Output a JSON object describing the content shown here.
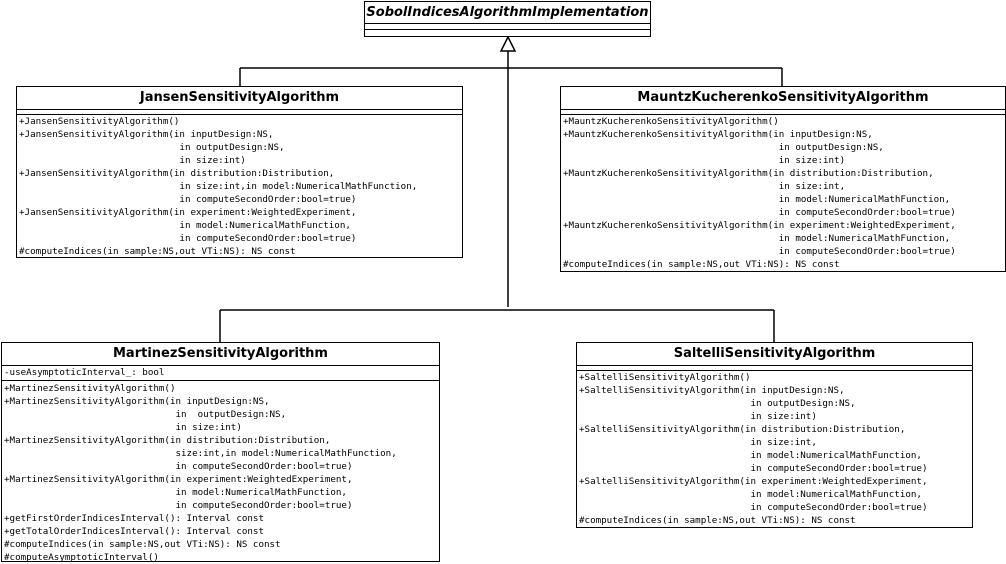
{
  "parent": {
    "name": "SobolIndicesAlgorithmImplementation"
  },
  "jansen": {
    "name": "JansenSensitivityAlgorithm",
    "operations": [
      "+JansenSensitivityAlgorithm()",
      "+JansenSensitivityAlgorithm(in inputDesign:NS,",
      "                             in outputDesign:NS,",
      "                             in size:int)",
      "+JansenSensitivityAlgorithm(in distribution:Distribution,",
      "                             in size:int,in model:NumericalMathFunction,",
      "                             in computeSecondOrder:bool=true)",
      "+JansenSensitivityAlgorithm(in experiment:WeightedExperiment,",
      "                             in model:NumericalMathFunction,",
      "                             in computeSecondOrder:bool=true)",
      "#computeIndices(in sample:NS,out VTi:NS): NS const"
    ]
  },
  "mauntz": {
    "name": "MauntzKucherenkoSensitivityAlgorithm",
    "operations": [
      "+MauntzKucherenkoSensitivityAlgorithm()",
      "+MauntzKucherenkoSensitivityAlgorithm(in inputDesign:NS,",
      "                                       in outputDesign:NS,",
      "                                       in size:int)",
      "+MauntzKucherenkoSensitivityAlgorithm(in distribution:Distribution,",
      "                                       in size:int,",
      "                                       in model:NumericalMathFunction,",
      "                                       in computeSecondOrder:bool=true)",
      "+MauntzKucherenkoSensitivityAlgorithm(in experiment:WeightedExperiment,",
      "                                       in model:NumericalMathFunction,",
      "                                       in computeSecondOrder:bool=true)",
      "#computeIndices(in sample:NS,out VTi:NS): NS const"
    ]
  },
  "martinez": {
    "name": "MartinezSensitivityAlgorithm",
    "attributes": [
      "-useAsymptoticInterval_: bool"
    ],
    "operations": [
      "+MartinezSensitivityAlgorithm()",
      "+MartinezSensitivityAlgorithm(in inputDesign:NS,",
      "                               in  outputDesign:NS,",
      "                               in size:int)",
      "+MartinezSensitivityAlgorithm(in distribution:Distribution,",
      "                               size:int,in model:NumericalMathFunction,",
      "                               in computeSecondOrder:bool=true)",
      "+MartinezSensitivityAlgorithm(in experiment:WeightedExperiment,",
      "                               in model:NumericalMathFunction,",
      "                               in computeSecondOrder:bool=true)",
      "+getFirstOrderIndicesInterval(): Interval const",
      "+getTotalOrderIndicesInterval(): Interval const",
      "#computeIndices(in sample:NS,out VTi:NS): NS const",
      "#computeAsymptoticInterval()"
    ]
  },
  "saltelli": {
    "name": "SaltelliSensitivityAlgorithm",
    "operations": [
      "+SaltelliSensitivityAlgorithm()",
      "+SaltelliSensitivityAlgorithm(in inputDesign:NS,",
      "                               in outputDesign:NS,",
      "                               in size:int)",
      "+SaltelliSensitivityAlgorithm(in distribution:Distribution,",
      "                               in size:int,",
      "                               in model:NumericalMathFunction,",
      "                               in computeSecondOrder:bool=true)",
      "+SaltelliSensitivityAlgorithm(in experiment:WeightedExperiment,",
      "                               in model:NumericalMathFunction,",
      "                               in computeSecondOrder:bool=true)",
      "#computeIndices(in sample:NS,out VTi:NS): NS const"
    ]
  }
}
